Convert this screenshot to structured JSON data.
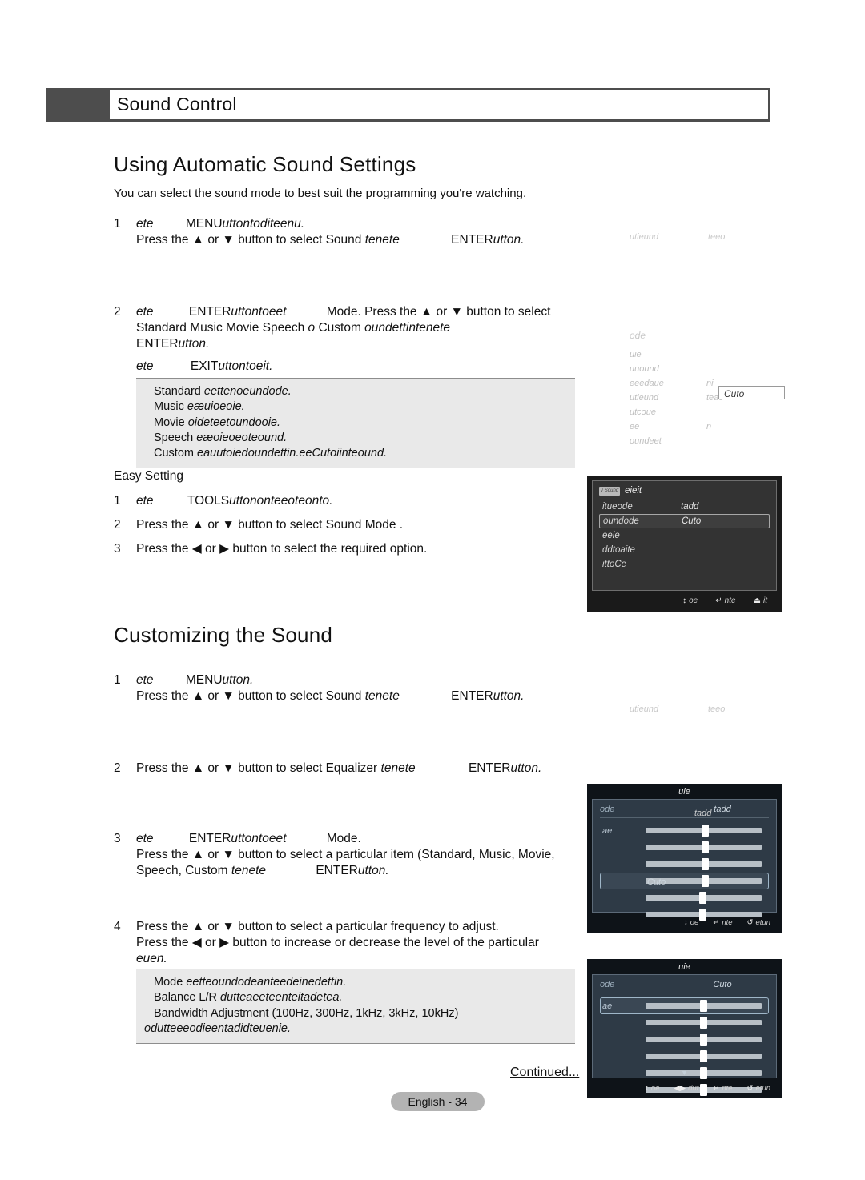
{
  "chapter": {
    "title": "Sound Control"
  },
  "sections": {
    "auto": {
      "heading": "Using Automatic Sound Settings",
      "intro": "You can select the sound mode to best suit the programming you're watching.",
      "steps": [
        {
          "num": "1",
          "line1_a": "ete",
          "line1_b": "MENU",
          "line1_c": "uttontoditeenu.",
          "line2_a": "Press the ▲ or ▼ button to select Sound ",
          "line2_b": "tenete",
          "line2_c": "ENTER",
          "line2_d": "utton."
        },
        {
          "num": "2",
          "line1_a": "ete",
          "line1_b": "ENTER",
          "line1_c": "uttontoeet",
          "line1_d": "Mode",
          "line1_e": ". Press the ▲ or ▼ button to select",
          "line2_a": "Standard   Music   Movie   Speech ",
          "line2_b": "o",
          "line2_c": "   Custom ",
          "line2_d": "oundettintenete",
          "line3_a": "ENTER",
          "line3_b": "utton."
        }
      ],
      "exit_note_a": "ete",
      "exit_note_b": "EXIT",
      "exit_note_c": "uttontoeit.",
      "notebox": [
        {
          "label": "Standard ",
          "ital": "eettenoeundode."
        },
        {
          "label": "Music ",
          "ital": "eæuioeoie."
        },
        {
          "label": "Movie ",
          "ital": "oideteetoundooie."
        },
        {
          "label": "Speech ",
          "ital": "eæoieoeoteound."
        },
        {
          "label": "Custom ",
          "ital": "eauutoiedoundettin.eeCutoiinteound."
        }
      ],
      "easy": {
        "title": "Easy Setting",
        "steps": [
          {
            "num": "1",
            "a": "ete",
            "b": "TOOLS",
            "c": "uttononteeoteonto."
          },
          {
            "num": "2",
            "text": "Press the ▲ or ▼ button to select Sound Mode ."
          },
          {
            "num": "3",
            "text": "Press the ◀ or ▶ button to select the required option."
          }
        ]
      }
    },
    "custom": {
      "heading": "Customizing the Sound",
      "steps": [
        {
          "num": "1",
          "line1_a": "ete",
          "line1_b": "MENU",
          "line1_c": "utton.",
          "line2_a": "Press the ▲ or ▼ button to select Sound ",
          "line2_b": "tenete",
          "line2_c": "ENTER",
          "line2_d": "utton."
        },
        {
          "num": "2",
          "line1_a": "Press the ▲ or ▼ button to select Equalizer ",
          "line1_b": "tenete",
          "line1_c": "ENTER",
          "line1_d": "utton."
        },
        {
          "num": "3",
          "line1_a": "ete",
          "line1_b": "ENTER",
          "line1_c": "uttontoeet",
          "line1_d": "Mode",
          "line1_e": ".",
          "line2": "Press the ▲ or ▼ button to select a particular item (Standard, Music, Movie,",
          "line3_a": "Speech, Custom  ",
          "line3_b": "tenete",
          "line3_c": "ENTER",
          "line3_d": "utton."
        },
        {
          "num": "4",
          "line1": "Press the ▲ or ▼ button to select a particular frequency to adjust.",
          "line2": "Press the ◀ or ▶ button to increase or decrease the level of the particular",
          "line3": "euen."
        }
      ],
      "notebox": [
        {
          "label": "Mode ",
          "ital": "eetteoundodeanteedeinedettin."
        },
        {
          "label": "Balance L/R ",
          "ital": "dutteaeeteenteitadetea."
        },
        {
          "label": "Bandwidth Adjustment (100Hz,    300Hz, 1kHz, 3kHz, 10kHz)",
          "ital": ""
        },
        {
          "label": "",
          "ital": "odutteeeodieentadidteuenie."
        }
      ]
    }
  },
  "ghosts": {
    "top_right_1": {
      "a": "utieund",
      "b": "teeo"
    },
    "mid_right_2": {
      "a": "utieund",
      "b": "teeo"
    },
    "menu_panel": {
      "title": "ode",
      "rows": [
        {
          "k": "uie",
          "v": ""
        },
        {
          "k": "uuound",
          "v": ""
        },
        {
          "k": "eeedaue",
          "v": "ni"
        },
        {
          "k": "utieund",
          "v": "teao"
        },
        {
          "k": "utcoue",
          "v": ""
        },
        {
          "k": "ee",
          "v": "n"
        },
        {
          "k": "oundeet",
          "v": ""
        }
      ],
      "callout": "Cuto"
    }
  },
  "osd_tools": {
    "logo": "√ Sound",
    "title": "eieit",
    "rows": [
      {
        "key": "itueode",
        "value": "tadd",
        "selected": false
      },
      {
        "key": "oundode",
        "value": "Cuto",
        "selected": true
      },
      {
        "key": "eeie",
        "value": "",
        "selected": false
      },
      {
        "key": "ddtoaite",
        "value": "",
        "selected": false
      },
      {
        "key": "ittoCe",
        "value": "",
        "selected": false
      }
    ],
    "bar": [
      {
        "icon": "↕",
        "label": "oe"
      },
      {
        "icon": "↵",
        "label": "nte"
      },
      {
        "icon": "⏏",
        "label": "it"
      }
    ]
  },
  "osd_eq_top": {
    "title": "uie",
    "mode_key": "ode",
    "mode_value": "tadd",
    "ghost_value": "tadd",
    "rows": [
      {
        "label": "ae",
        "value": 52,
        "selected": false
      },
      {
        "label": "",
        "value": 52,
        "selected": false
      },
      {
        "label": "",
        "value": 52,
        "selected": false
      },
      {
        "label": "",
        "value": 52,
        "selected": true,
        "overlay": "Cuto"
      },
      {
        "label": "",
        "value": 50,
        "selected": false
      },
      {
        "label": "",
        "value": 50,
        "selected": false
      }
    ],
    "bar": [
      {
        "icon": "↕",
        "label": "oe"
      },
      {
        "icon": "↵",
        "label": "nte"
      },
      {
        "icon": "↺",
        "label": "etun"
      }
    ]
  },
  "osd_eq_bottom": {
    "title": "uie",
    "mode_key": "ode",
    "mode_value": "Cuto",
    "rows": [
      {
        "label": "ae",
        "value": 50,
        "selected": true
      },
      {
        "label": "",
        "value": 50,
        "selected": false
      },
      {
        "label": "",
        "value": 50,
        "selected": false
      },
      {
        "label": "",
        "value": 50,
        "selected": false
      },
      {
        "label": "",
        "value": 50,
        "selected": false
      },
      {
        "label": "",
        "value": 50,
        "selected": false
      }
    ],
    "down_arrow": "▼",
    "bar": [
      {
        "icon": "↕",
        "label": "oe"
      },
      {
        "icon": "◀▶",
        "label": "dut"
      },
      {
        "icon": "↵",
        "label": "nte"
      },
      {
        "icon": "↺",
        "label": "etun"
      }
    ]
  },
  "footer": {
    "continued": "Continued...",
    "page": "English - 34"
  },
  "colors": {
    "chapter_bar": "#4d4d4d",
    "note_bg": "#e9e9e9",
    "tools_bg": "#1a1a1a",
    "eq_panel": "#2e3a46",
    "page_badge": "#b3b3b3"
  }
}
